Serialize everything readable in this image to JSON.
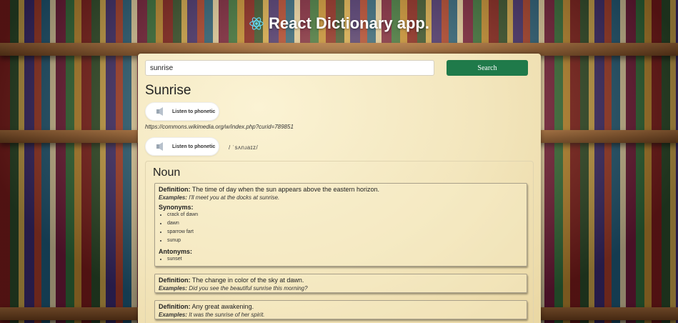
{
  "app": {
    "title": "React Dictionary app."
  },
  "search": {
    "value": "sunrise",
    "button_label": "Search"
  },
  "word": "Sunrise",
  "phonetics": [
    {
      "button_label": "Listen to phonetic",
      "audio_url": "https://commons.wikimedia.org/w/index.php?curid=789851"
    },
    {
      "button_label": "Listen to phonetic",
      "text": "/ ˈsʌnɹaɪz/"
    }
  ],
  "meaning": {
    "part_of_speech": "Noun",
    "definitions": [
      {
        "definition_label": "Definition:",
        "definition": "The time of day when the sun appears above the eastern horizon.",
        "example_label": "Examples:",
        "example": "I'll meet you at the docks at sunrise.",
        "synonyms_label": "Synonyms:",
        "synonyms": [
          "crack of dawn",
          "dawn",
          "sparrow fart",
          "sunup"
        ],
        "antonyms_label": "Antonyms:",
        "antonyms": [
          "sunset"
        ]
      },
      {
        "definition_label": "Definition:",
        "definition": "The change in color of the sky at dawn.",
        "example_label": "Examples:",
        "example": "Did you see the beautiful sunrise this morning?"
      },
      {
        "definition_label": "Definition:",
        "definition": "Any great awakening.",
        "example_label": "Examples:",
        "example": "It was the sunrise of her spirit."
      }
    ]
  },
  "colors": {
    "search_button": "#1f7a4a",
    "panel": "#f3e6bd"
  }
}
